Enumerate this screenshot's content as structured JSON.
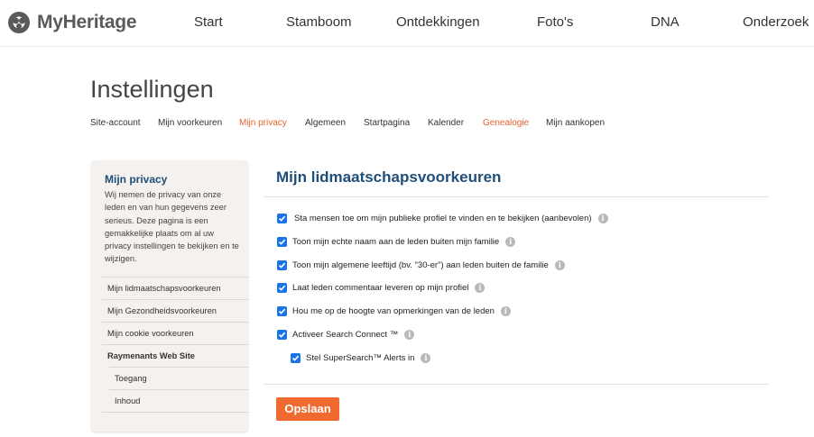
{
  "brand": {
    "name": "MyHeritage",
    "logo_icon": "myheritage-logo-icon"
  },
  "nav": {
    "items": [
      {
        "label": "Start"
      },
      {
        "label": "Stamboom"
      },
      {
        "label": "Ontdekkingen"
      },
      {
        "label": "Foto's"
      },
      {
        "label": "DNA"
      },
      {
        "label": "Onderzoek"
      }
    ]
  },
  "page": {
    "title": "Instellingen"
  },
  "subnav": {
    "items": [
      {
        "label": "Site-account"
      },
      {
        "label": "Mijn voorkeuren"
      },
      {
        "label": "Mijn privacy",
        "active": true
      },
      {
        "label": "Algemeen"
      },
      {
        "label": "Startpagina"
      },
      {
        "label": "Kalender"
      },
      {
        "label": "Genealogie",
        "active": true
      },
      {
        "label": "Mijn aankopen"
      }
    ],
    "active_color": "#e8622c"
  },
  "sidebar": {
    "title": "Mijn privacy",
    "description": "Wij nemen de privacy van onze leden en van hun gegevens zeer serieus. Deze pagina is een gemakkelijke plaats om al uw privacy instellingen te bekijken en te wijzigen.",
    "items": [
      {
        "label": "Mijn lidmaatschapsvoorkeuren"
      },
      {
        "label": "Mijn Gezondheidsvoorkeuren"
      },
      {
        "label": "Mijn cookie voorkeuren"
      },
      {
        "label": "Raymenants Web Site"
      },
      {
        "label": "Toegang"
      },
      {
        "label": "Inhoud"
      }
    ]
  },
  "main": {
    "section_title": "Mijn lidmaatschapsvoorkeuren",
    "options": [
      {
        "label": "Sta mensen toe om mijn publieke profiel te vinden en te bekijken (aanbevolen)",
        "checked": true
      },
      {
        "label": "Toon mijn echte naam aan de leden buiten mijn familie",
        "checked": true
      },
      {
        "label": "Toon mijn algemene leeftijd (bv. \"30-er\") aan leden buiten de familie",
        "checked": true
      },
      {
        "label": "Laat leden commentaar leveren op mijn profiel",
        "checked": true
      },
      {
        "label": "Hou me op de hoogte van opmerkingen van de leden",
        "checked": true
      },
      {
        "label": "Activeer Search Connect ™",
        "checked": true
      },
      {
        "label": "Stel SuperSearch™ Alerts in",
        "checked": true
      }
    ],
    "info_icon": "info-icon",
    "info_glyph": "i",
    "save_label": "Opslaan"
  },
  "colors": {
    "accent": "#f06a30",
    "heading": "#1f4e79",
    "checkbox": "#1a73e8"
  }
}
